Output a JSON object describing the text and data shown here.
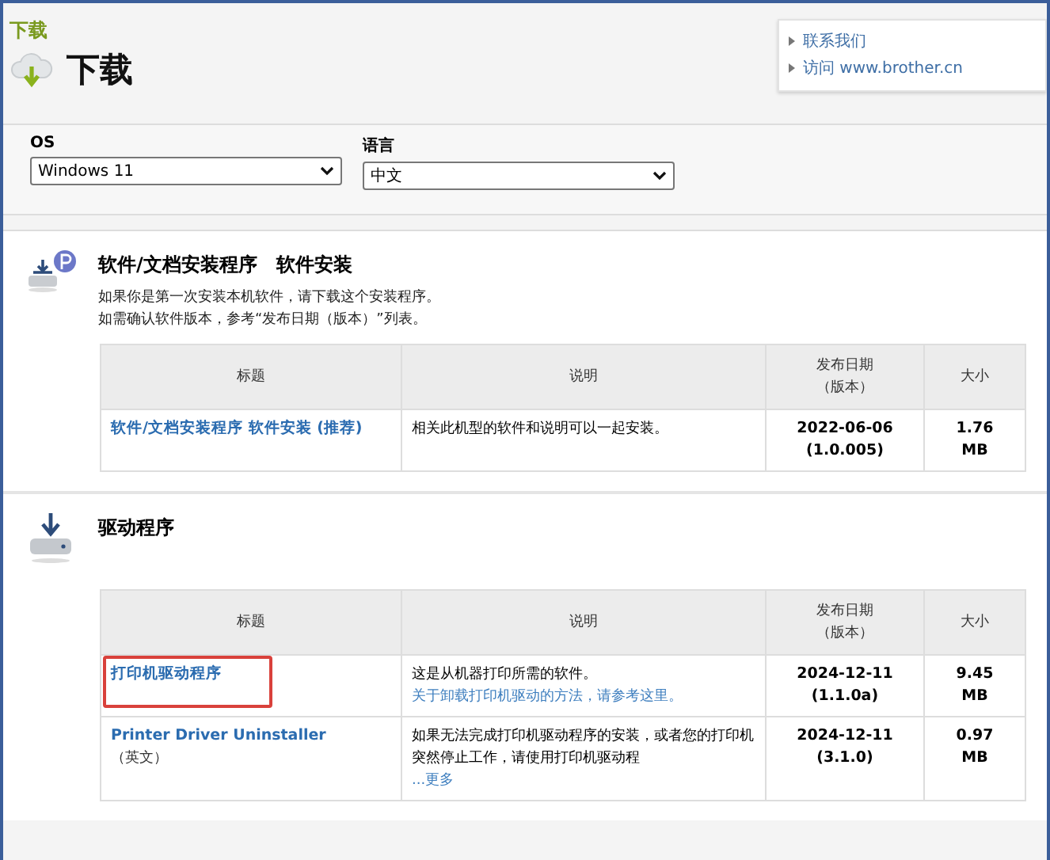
{
  "breadcrumb": "下载",
  "title": "下载",
  "links": [
    "联系我们",
    "访问 www.brother.cn"
  ],
  "filters": [
    {
      "label": "OS",
      "value": "Windows 11"
    },
    {
      "label": "语言",
      "value": "中文"
    }
  ],
  "sections": [
    {
      "kind": "installer",
      "title": "软件/文档安装程序　软件安装",
      "intro": [
        "如果你是第一次安装本机软件，请下载这个安装程序。",
        "如需确认软件版本，参考“发布日期（版本）”列表。"
      ],
      "columns": [
        "标题",
        "说明",
        "发布日期（版本）",
        "大小"
      ],
      "rows": [
        {
          "title": "软件/文档安装程序 软件安装 (推荐)",
          "highlighted": false,
          "description": "相关此机型的软件和说明可以一起安装。",
          "date": "2022-06-06\n(1.0.005)",
          "size": "1.76\nMB"
        }
      ]
    },
    {
      "kind": "driver",
      "title": "驱动程序",
      "columns": [
        "标题",
        "说明",
        "发布日期（版本）",
        "大小"
      ],
      "rows": [
        {
          "title": "打印机驱动程序",
          "highlighted": true,
          "description": "这是从机器打印所需的软件。",
          "description_link": "关于卸载打印机驱动的方法，请参考这里。",
          "date": "2024-12-11\n(1.1.0a)",
          "size": "9.45\nMB"
        },
        {
          "title": "Printer Driver Uninstaller",
          "title_note": "（英文）",
          "highlighted": false,
          "description": "如果无法完成打印机驱动程序的安装，或者您的打印机突然停止工作，请使用打印机驱动程",
          "more": "...更多",
          "date": "2024-12-11\n(3.1.0)",
          "size": "0.97\nMB"
        }
      ]
    }
  ]
}
